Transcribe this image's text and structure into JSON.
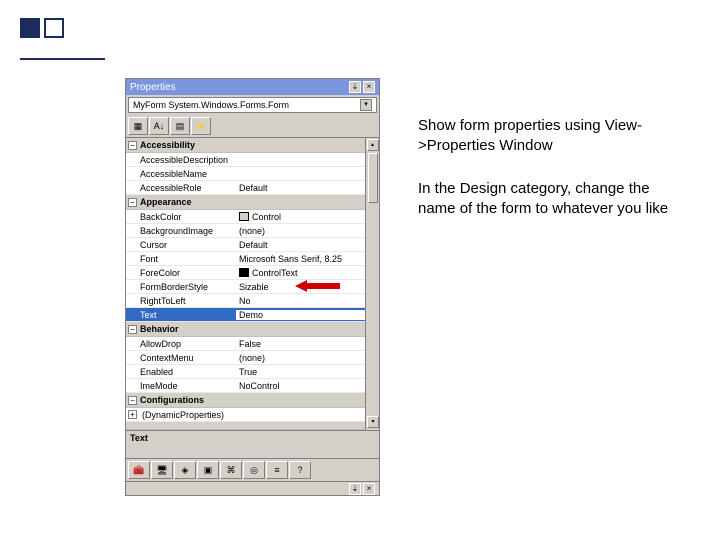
{
  "panel": {
    "title": "Properties",
    "object_selector": "MyForm   System.Windows.Forms.Form",
    "toolbar_icons": [
      "categorized",
      "alphabetical",
      "properties",
      "events"
    ],
    "categories": {
      "accessibility": {
        "label": "Accessibility",
        "rows": [
          {
            "name": "AccessibleDescription",
            "value": ""
          },
          {
            "name": "AccessibleName",
            "value": ""
          },
          {
            "name": "AccessibleRole",
            "value": "Default"
          }
        ]
      },
      "appearance": {
        "label": "Appearance",
        "rows": [
          {
            "name": "BackColor",
            "value": "Control"
          },
          {
            "name": "BackgroundImage",
            "value": "(none)"
          },
          {
            "name": "Cursor",
            "value": "Default"
          },
          {
            "name": "Font",
            "value": "Microsoft Sans Serif, 8.25"
          },
          {
            "name": "ForeColor",
            "value": "ControlText"
          },
          {
            "name": "FormBorderStyle",
            "value": "Sizable"
          },
          {
            "name": "RightToLeft",
            "value": "No"
          },
          {
            "name": "Text",
            "value": "Demo"
          }
        ]
      },
      "behavior": {
        "label": "Behavior",
        "rows": [
          {
            "name": "AllowDrop",
            "value": "False"
          },
          {
            "name": "ContextMenu",
            "value": "(none)"
          },
          {
            "name": "Enabled",
            "value": "True"
          },
          {
            "name": "ImeMode",
            "value": "NoControl"
          }
        ]
      },
      "configurations": {
        "label": "Configurations"
      },
      "dynamic": {
        "label": "(DynamicProperties)"
      }
    },
    "description_title": "Text"
  },
  "instructions": {
    "p1": "Show form properties using View->Properties Window",
    "p2": "In the Design category, change the name of the form to whatever you like"
  },
  "glyphs": {
    "minus": "−",
    "plus": "+",
    "pin": "⇣",
    "close": "×",
    "down": "▾",
    "up": "▴",
    "az": "A↓"
  }
}
